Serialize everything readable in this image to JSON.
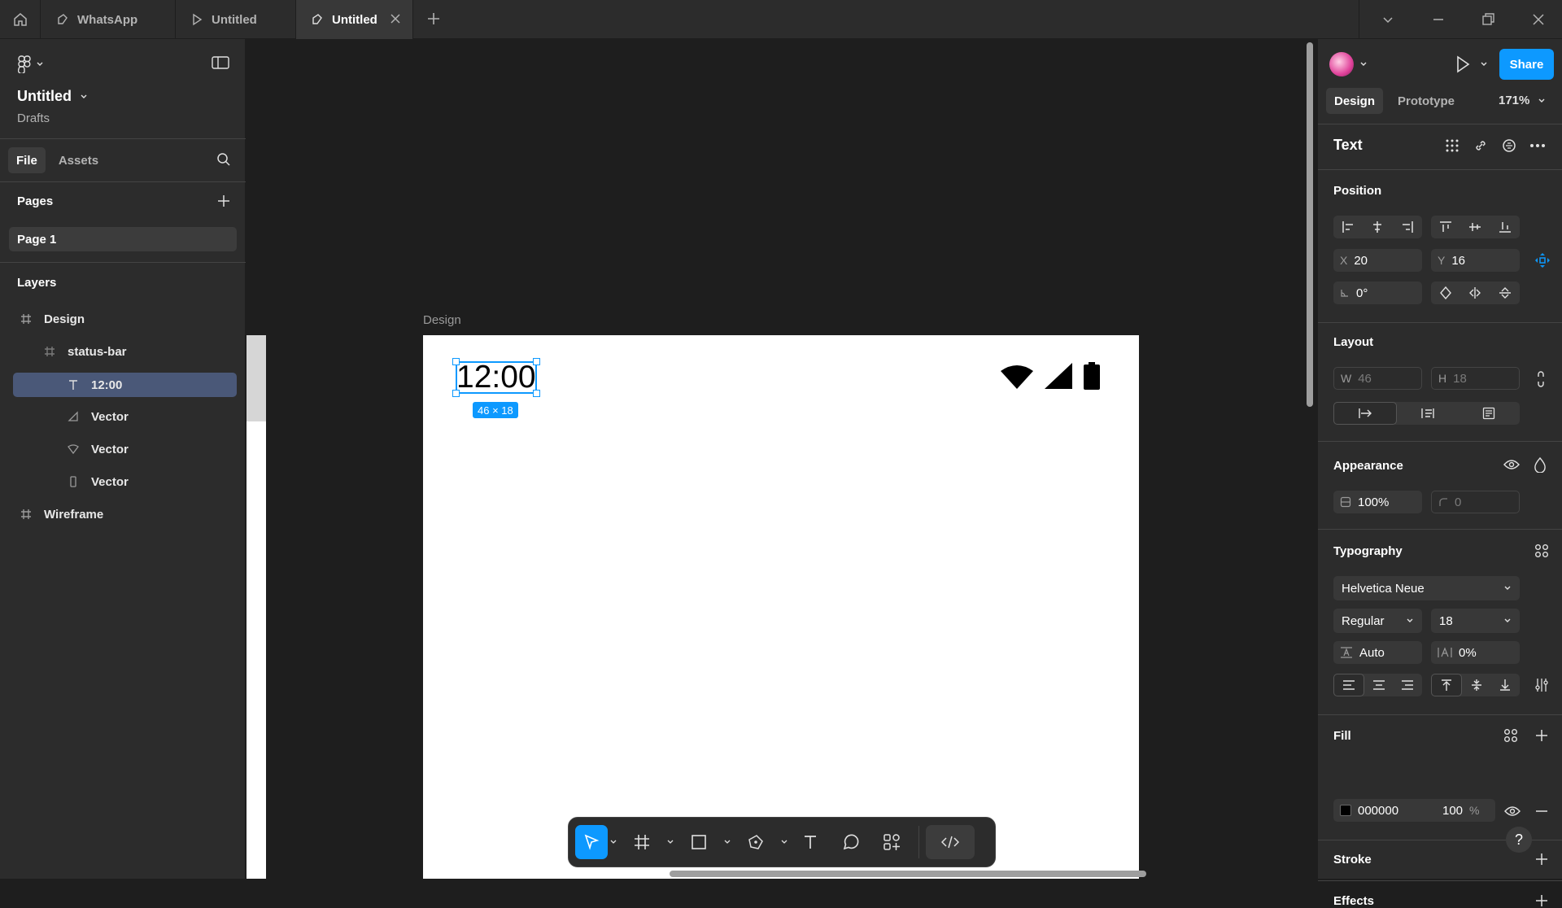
{
  "tabs": [
    {
      "label": "WhatsApp",
      "icon": "figma-file-icon"
    },
    {
      "label": "Untitled",
      "icon": "play-file-icon"
    },
    {
      "label": "Untitled",
      "icon": "figma-file-icon"
    }
  ],
  "file": {
    "title": "Untitled",
    "location": "Drafts"
  },
  "left_tabs": [
    "File",
    "Assets"
  ],
  "pages": {
    "title": "Pages",
    "items": [
      "Page 1"
    ]
  },
  "layers": {
    "title": "Layers",
    "items": [
      {
        "label": "Design",
        "icon": "frame-icon"
      },
      {
        "label": "status-bar",
        "icon": "frame-icon"
      },
      {
        "label": "12:00",
        "icon": "text-icon"
      },
      {
        "label": "Vector",
        "icon": "triangle-vector-icon"
      },
      {
        "label": "Vector",
        "icon": "shield-vector-icon"
      },
      {
        "label": "Vector",
        "icon": "rect-vector-icon"
      },
      {
        "label": "Wireframe",
        "icon": "frame-icon"
      }
    ]
  },
  "canvas": {
    "frame_label": "Design",
    "clock_text": "12:00",
    "selection_size": "46 × 18"
  },
  "right": {
    "share": "Share",
    "tabs": [
      "Design",
      "Prototype"
    ],
    "zoom": "171%",
    "selection_type": "Text",
    "position": {
      "title": "Position",
      "x_label": "X",
      "x": "20",
      "y_label": "Y",
      "y": "16",
      "rotation": "0°"
    },
    "layout": {
      "title": "Layout",
      "w_label": "W",
      "w": "46",
      "h_label": "H",
      "h": "18"
    },
    "appearance": {
      "title": "Appearance",
      "opacity": "100%",
      "radius": "0"
    },
    "typography": {
      "title": "Typography",
      "font": "Helvetica Neue",
      "weight": "Regular",
      "size": "18",
      "line_height": "Auto",
      "letter_spacing": "0%"
    },
    "fill": {
      "title": "Fill",
      "hex": "000000",
      "opacity": "100",
      "unit": "%"
    },
    "stroke": {
      "title": "Stroke"
    },
    "effects": {
      "title": "Effects"
    }
  },
  "help": "?",
  "colors": {
    "accent": "#0d99ff",
    "panel": "#2c2c2c",
    "canvas": "#1e1e1e",
    "selected_layer": "#4a5878"
  }
}
